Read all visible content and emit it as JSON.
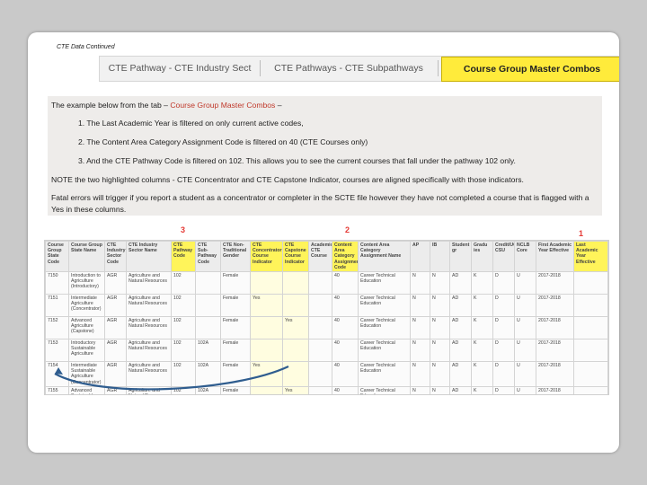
{
  "slide": {
    "header_title": "CTE Data Continued",
    "tabs": [
      {
        "label": "CTE Pathway - CTE Industry Sect",
        "active": false
      },
      {
        "label": "CTE Pathways - CTE Subpathways",
        "active": false
      },
      {
        "label": "Course Group Master Combos",
        "active": true
      }
    ],
    "description": {
      "intro_prefix": "The example below from the tab – ",
      "intro_highlight": "Course Group Master Combos",
      "intro_suffix": " –",
      "steps": [
        "1.  The Last Academic Year is filtered on only current active codes,",
        "2.  The Content Area Category Assignment Code is filtered on 40 (CTE Courses only)",
        "3.  And the CTE Pathway Code is filtered on 102.   This allows you to see the current courses that fall under the pathway 102 only."
      ],
      "note": "NOTE the two highlighted columns - CTE Concentrator and CTE Capstone Indicator, courses are aligned specifically with those indicators.",
      "fatal": "Fatal errors will trigger if you report a student as a concentrator or completer in the SCTE file however they have not completed a course that is flagged with a Yes in these columns."
    },
    "markers": [
      "3",
      "2",
      "1"
    ],
    "colors": {
      "highlight_yellow": "#fff45a",
      "active_tab": "#ffeb3b",
      "marker_red": "#e53935",
      "arrow_blue": "#2f5d8f"
    }
  },
  "sheet": {
    "columns": [
      {
        "label": "Course Group State Code",
        "highlight": false
      },
      {
        "label": "Course Group State Name",
        "highlight": false
      },
      {
        "label": "CTE Industry Sector Code",
        "highlight": false
      },
      {
        "label": "CTE Industry Sector Name",
        "highlight": false
      },
      {
        "label": "CTE Pathway Code",
        "highlight": true
      },
      {
        "label": "CTE Sub-Pathway Code",
        "highlight": false
      },
      {
        "label": "CTE Non-Traditional Gender",
        "highlight": false
      },
      {
        "label": "CTE Concentrator Course Indicator",
        "highlight": true
      },
      {
        "label": "CTE Capstone Course Indicator",
        "highlight": true
      },
      {
        "label": "Academic CTE Course",
        "highlight": false
      },
      {
        "label": "Content Area Category Assignment Code",
        "highlight": true
      },
      {
        "label": "Content Area Category Assignment Name",
        "highlight": false
      },
      {
        "label": "AP",
        "highlight": false
      },
      {
        "label": "IB",
        "highlight": false
      },
      {
        "label": "Student gr",
        "highlight": false
      },
      {
        "label": "Gradu ies",
        "highlight": false
      },
      {
        "label": "Credit/UC CSU",
        "highlight": false
      },
      {
        "label": "NCLB Core",
        "highlight": false
      },
      {
        "label": "First Academic Year Effective",
        "highlight": false
      },
      {
        "label": "Last Academic Year Effective",
        "highlight": true
      }
    ],
    "rows": [
      [
        "7150",
        "Introduction to Agriculture (Introductory)",
        "AGR",
        "Agriculture and Natural Resources",
        "102",
        "",
        "Female",
        "",
        "",
        "",
        "40",
        "Career Technical Education",
        "N",
        "N",
        "AD",
        "K",
        "D",
        "U",
        "2017-2018",
        ""
      ],
      [
        "7151",
        "Intermediate Agriculture (Concentrator)",
        "AGR",
        "Agriculture and Natural Resources",
        "102",
        "",
        "Female",
        "Yes",
        "",
        "",
        "40",
        "Career Technical Education",
        "N",
        "N",
        "AD",
        "K",
        "D",
        "U",
        "2017-2018",
        ""
      ],
      [
        "7152",
        "Advanced Agriculture (Capstone)",
        "AGR",
        "Agriculture and Natural Resources",
        "102",
        "",
        "Female",
        "",
        "Yes",
        "",
        "40",
        "Career Technical Education",
        "N",
        "N",
        "AD",
        "K",
        "D",
        "U",
        "2017-2018",
        ""
      ],
      [
        "7153",
        "Introductory Sustainable Agriculture",
        "AGR",
        "Agriculture and Natural Resources",
        "102",
        "102A",
        "Female",
        "",
        "",
        "",
        "40",
        "Career Technical Education",
        "N",
        "N",
        "AD",
        "K",
        "D",
        "U",
        "2017-2018",
        ""
      ],
      [
        "7154",
        "Intermediate Sustainable Agriculture (Concentrator)",
        "AGR",
        "Agriculture and Natural Resources",
        "102",
        "102A",
        "Female",
        "Yes",
        "",
        "",
        "40",
        "Career Technical Education",
        "N",
        "N",
        "AD",
        "K",
        "D",
        "U",
        "2017-2018",
        ""
      ],
      [
        "7155",
        "Advanced Sustainable Agriculture (Capstone)",
        "AGR",
        "Agriculture and Natural Resources",
        "102",
        "102A",
        "Female",
        "",
        "Yes",
        "",
        "40",
        "Career Technical Education",
        "N",
        "N",
        "AD",
        "K",
        "D",
        "U",
        "2017-2018",
        ""
      ]
    ]
  }
}
